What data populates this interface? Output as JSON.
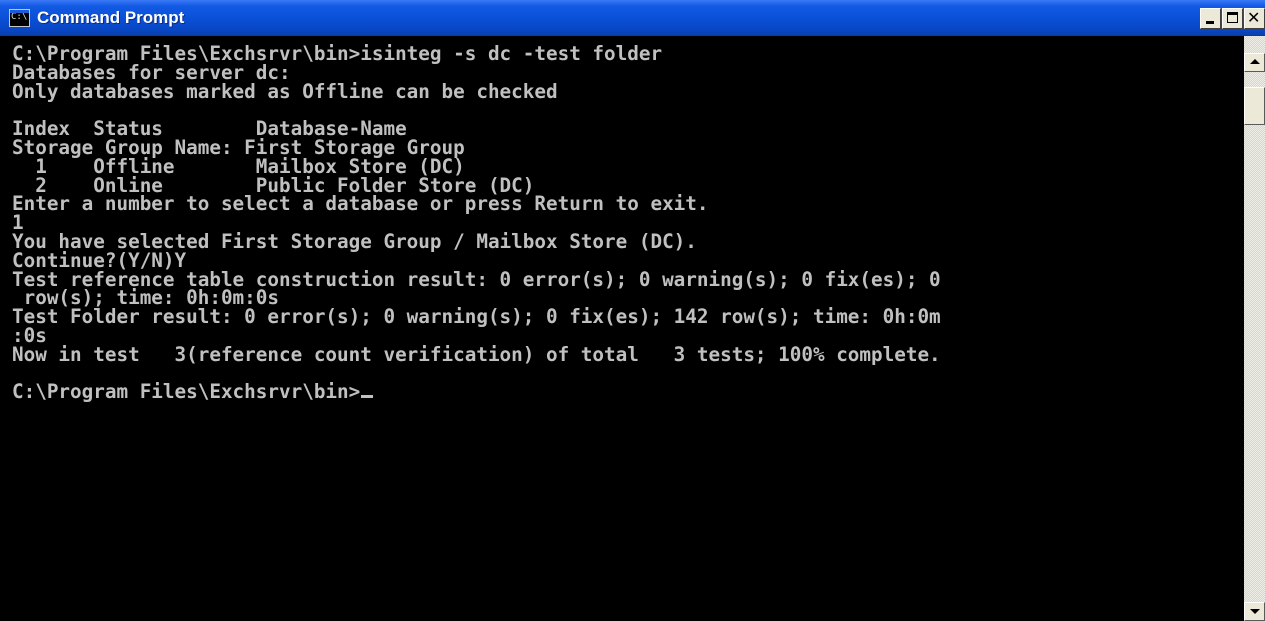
{
  "window": {
    "title": "Command Prompt",
    "icon_label": "C:\\"
  },
  "colors": {
    "titlebar": "#0a4fd6",
    "console_background": "#000000",
    "console_text": "#c0c0c0"
  },
  "console": {
    "lines": [
      "C:\\Program Files\\Exchsrvr\\bin>isinteg -s dc -test folder",
      "Databases for server dc:",
      "Only databases marked as Offline can be checked",
      "",
      "Index  Status        Database-Name",
      "Storage Group Name: First Storage Group",
      "  1    Offline       Mailbox Store (DC)",
      "  2    Online        Public Folder Store (DC)",
      "Enter a number to select a database or press Return to exit.",
      "1",
      "You have selected First Storage Group / Mailbox Store (DC).",
      "Continue?(Y/N)Y",
      "Test reference table construction result: 0 error(s); 0 warning(s); 0 fix(es); 0",
      " row(s); time: 0h:0m:0s",
      "Test Folder result: 0 error(s); 0 warning(s); 0 fix(es); 142 row(s); time: 0h:0m",
      ":0s",
      "Now in test   3(reference count verification) of total   3 tests; 100% complete.",
      "",
      "C:\\Program Files\\Exchsrvr\\bin>"
    ]
  }
}
